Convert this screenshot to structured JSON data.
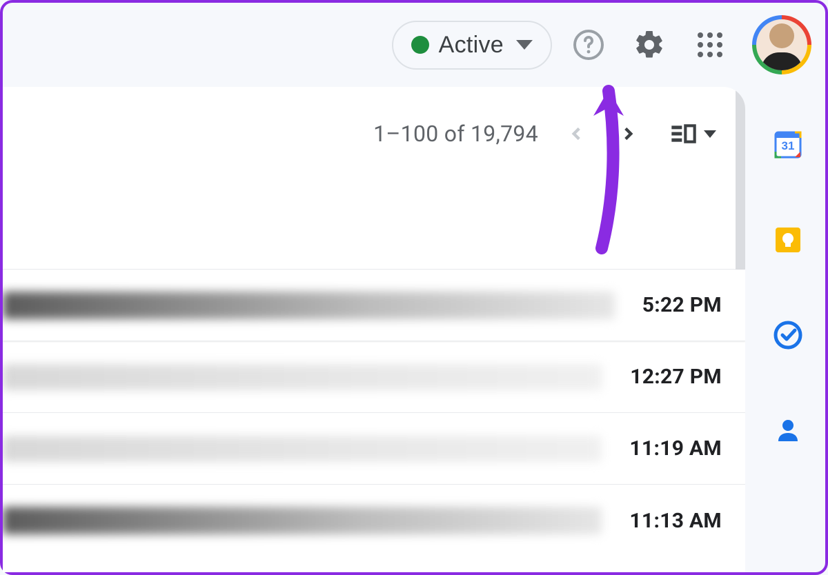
{
  "header": {
    "status_label": "Active",
    "status_color": "#1e8e3e"
  },
  "toolbar": {
    "page_count": "1–100 of 19,794"
  },
  "emails": [
    {
      "time": "5:22 PM",
      "unread": true
    },
    {
      "time": "12:27 PM",
      "unread": false
    },
    {
      "time": "11:19 AM",
      "unread": false
    },
    {
      "time": "11:13 AM",
      "unread": false
    }
  ],
  "side_rail": {
    "calendar_day": "31"
  }
}
